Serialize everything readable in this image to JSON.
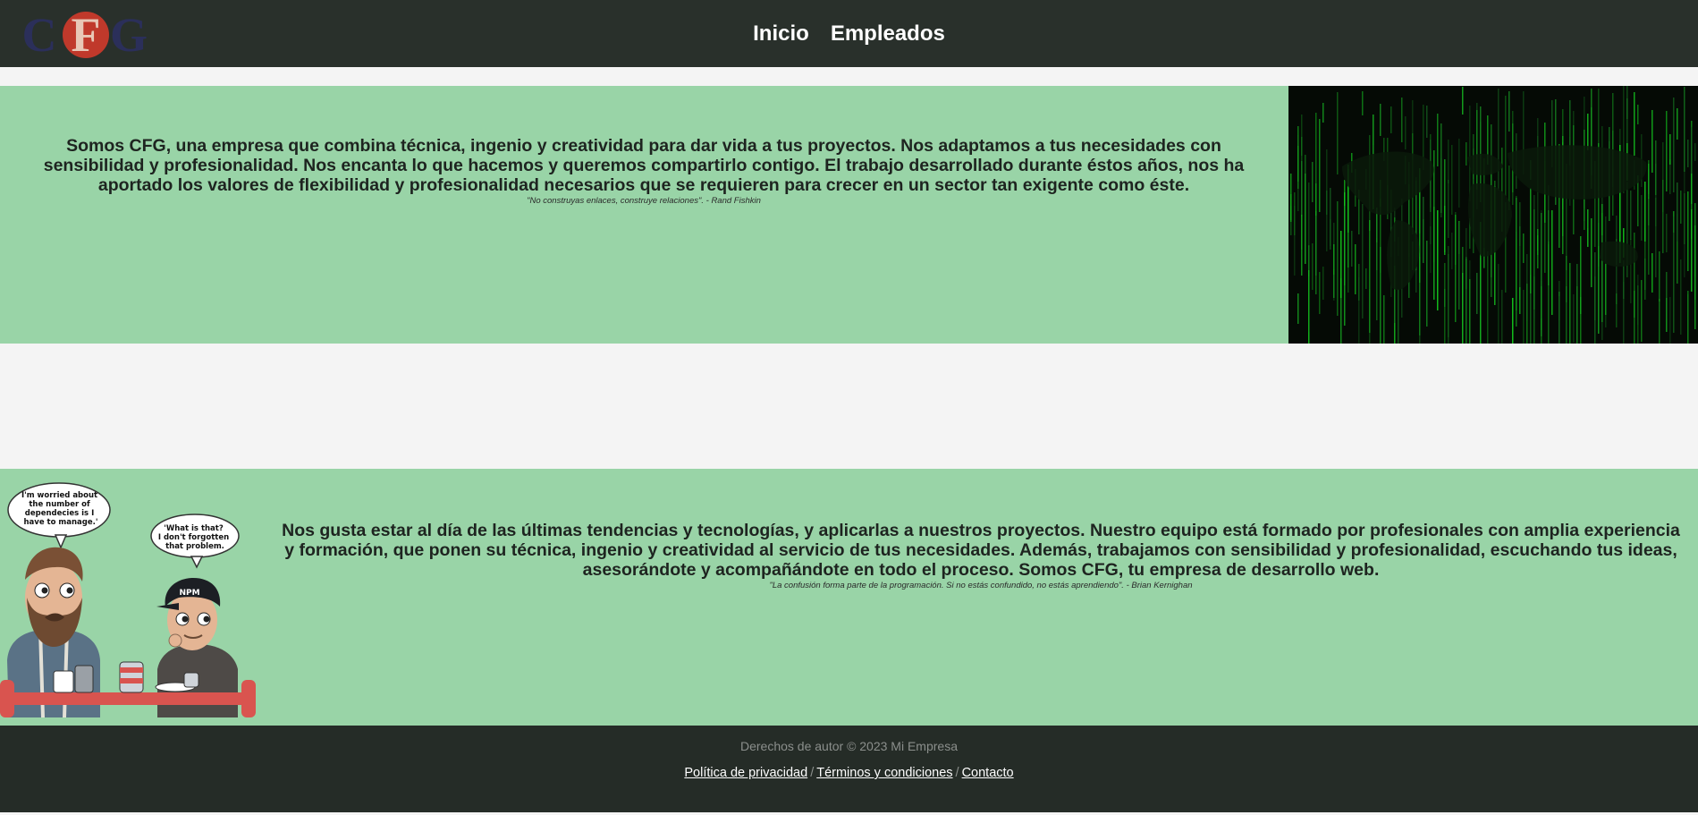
{
  "header": {
    "logo_letters": [
      "C",
      "F",
      "G"
    ],
    "nav": [
      {
        "label": "Inicio"
      },
      {
        "label": "Empleados"
      }
    ]
  },
  "section1": {
    "text": "Somos CFG, una empresa que combina técnica, ingenio y creatividad para dar vida a tus proyectos. Nos adaptamos a tus necesidades con sensibilidad y profesionalidad. Nos encanta lo que hacemos y queremos compartirlo contigo. El trabajo desarrollado durante éstos años, nos ha aportado los valores de flexibilidad y profesionalidad necesarios que se requieren para crecer en un sector tan exigente como éste.",
    "quote": "\"No construyas enlaces, construye relaciones\". - Rand Fishkin",
    "image_icon": "matrix-world-map-image"
  },
  "section2": {
    "text": "Nos gusta estar al día de las últimas tendencias y tecnologías, y aplicarlas a nuestros proyectos. Nuestro equipo está formado por profesionales con amplia experiencia y formación, que ponen su técnica, ingenio y creatividad al servicio de tus necesidades. Además, trabajamos con sensibilidad y profesionalidad, escuchando tus ideas, asesorándote y acompañándote en todo el proceso. Somos CFG, tu empresa de desarrollo web.",
    "quote": "\"La confusión forma parte de la programación. Si no estás confundido, no estás aprendiendo\". - Brian Kernighan",
    "image_icon": "developers-comic-image",
    "comic": {
      "bubble1": [
        "I'm worried about",
        "the number of",
        "dependecies is I",
        "have to manage.'"
      ],
      "bubble2": [
        "'What is that?",
        "I don't forgotten",
        "that problem."
      ],
      "cap_text": "NPM"
    }
  },
  "footer": {
    "copyright": "Derechos de autor © 2023 Mi Empresa",
    "links": [
      {
        "label": "Política de privacidad"
      },
      {
        "label": "Términos y condiciones"
      },
      {
        "label": "Contacto"
      }
    ],
    "separator": "/"
  },
  "colors": {
    "header_bg": "#29302b",
    "band_bg": "#99d4a7",
    "page_bg": "#f4f4f4",
    "footer_bg": "#252c27",
    "logo_red": "#c0392b",
    "logo_navy": "#2b2f5a"
  }
}
